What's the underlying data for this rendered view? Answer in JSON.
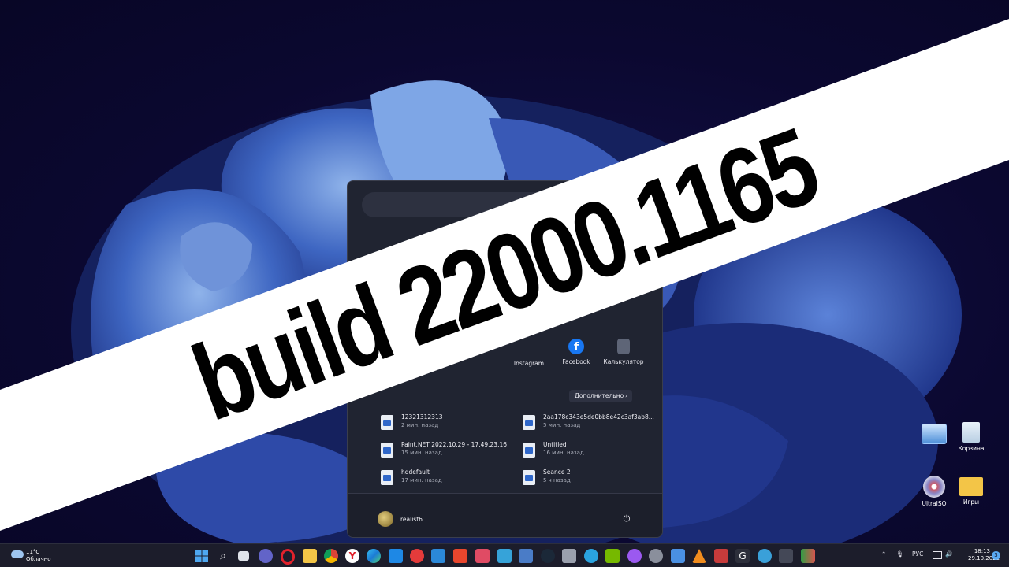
{
  "banner": {
    "text": "build 22000.1165"
  },
  "start_menu": {
    "pinned": [
      {
        "label": "Instagram",
        "icon": "instagram-icon"
      },
      {
        "label": "Facebook",
        "icon": "facebook-icon",
        "color": "#1877f2"
      },
      {
        "label": "Калькулятор",
        "icon": "calculator-icon"
      }
    ],
    "recommended_more": "Дополнительно",
    "recommended": [
      {
        "name": "12321312313",
        "time": "2 мин. назад"
      },
      {
        "name": "2aa178c343e5de0bb8e42c3af3ab8...",
        "time": "5 мин. назад"
      },
      {
        "name": "Paint.NET 2022.10.29 - 17.49.23.16",
        "time": "15 мин. назад"
      },
      {
        "name": "Untitled",
        "time": "16 мин. назад"
      },
      {
        "name": "hqdefault",
        "time": "17 мин. назад"
      },
      {
        "name": "Seance 2",
        "time": "5 ч назад"
      }
    ],
    "user": "realist6"
  },
  "desktop_icons": [
    {
      "label": "",
      "icon": "control-panel-icon"
    },
    {
      "label": "Корзина",
      "icon": "recycle-bin-icon"
    },
    {
      "label": "UltraISO",
      "icon": "ultraiso-icon"
    },
    {
      "label": "Игры",
      "icon": "folder-icon"
    }
  ],
  "taskbar": {
    "weather_temp": "11°C",
    "weather_desc": "Облачно",
    "language": "РУС",
    "time": "18:13",
    "date": "29.10.2022",
    "notifications": "3",
    "accent": "#5aa8f0"
  }
}
